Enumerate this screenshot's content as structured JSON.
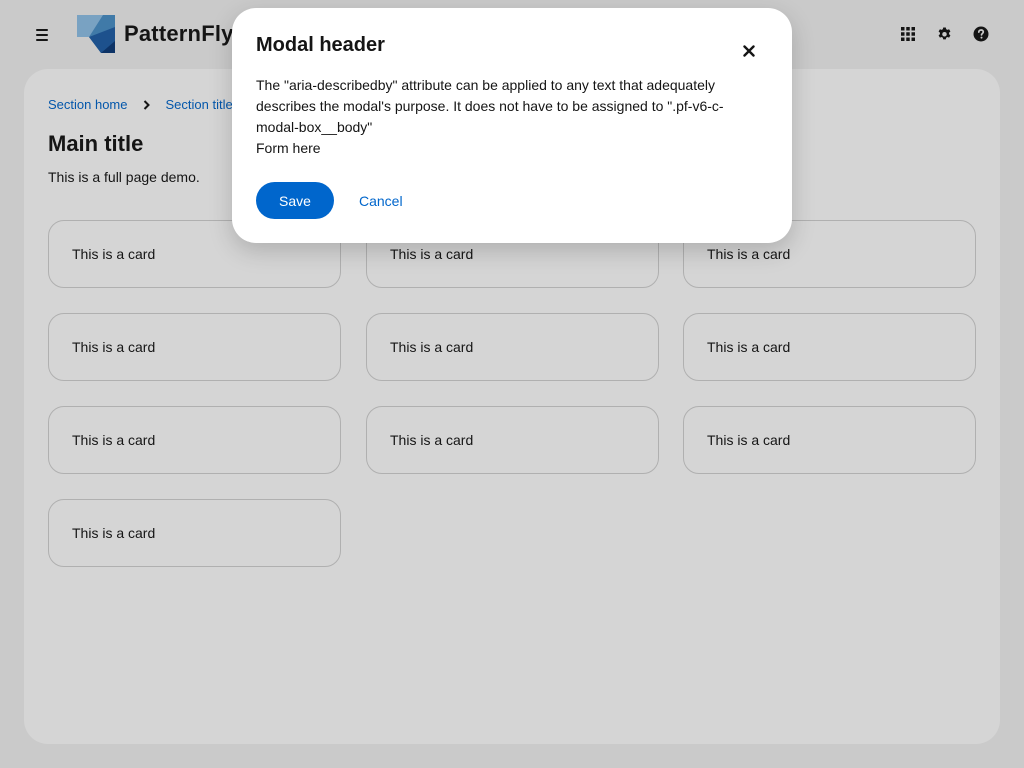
{
  "masthead": {
    "menu_icon": "hamburger-icon",
    "brand_name": "PatternFly",
    "tools": [
      {
        "icon": "grid-icon"
      },
      {
        "icon": "gear-icon"
      },
      {
        "icon": "help-icon"
      }
    ]
  },
  "breadcrumb": {
    "items": [
      "Section home",
      "Section title"
    ],
    "separator_icon": "chevron-right-icon"
  },
  "page": {
    "title": "Main title",
    "description": "This is a full page demo."
  },
  "cards": [
    "This is a card",
    "This is a card",
    "This is a card",
    "This is a card",
    "This is a card",
    "This is a card",
    "This is a card",
    "This is a card",
    "This is a card",
    "This is a card"
  ],
  "modal": {
    "title": "Modal header",
    "close_icon": "close-icon",
    "body_line1": "The \"aria-describedby\" attribute can be applied to any text that adequately describes the modal's purpose. It does not have to be assigned to \".pf-v6-c-modal-box__body\"",
    "body_line2": "Form here",
    "save_label": "Save",
    "cancel_label": "Cancel"
  },
  "colors": {
    "accent": "#0066cc",
    "page_bg": "#f2f2f2",
    "surface": "#ffffff",
    "border": "#d2d2d2"
  }
}
